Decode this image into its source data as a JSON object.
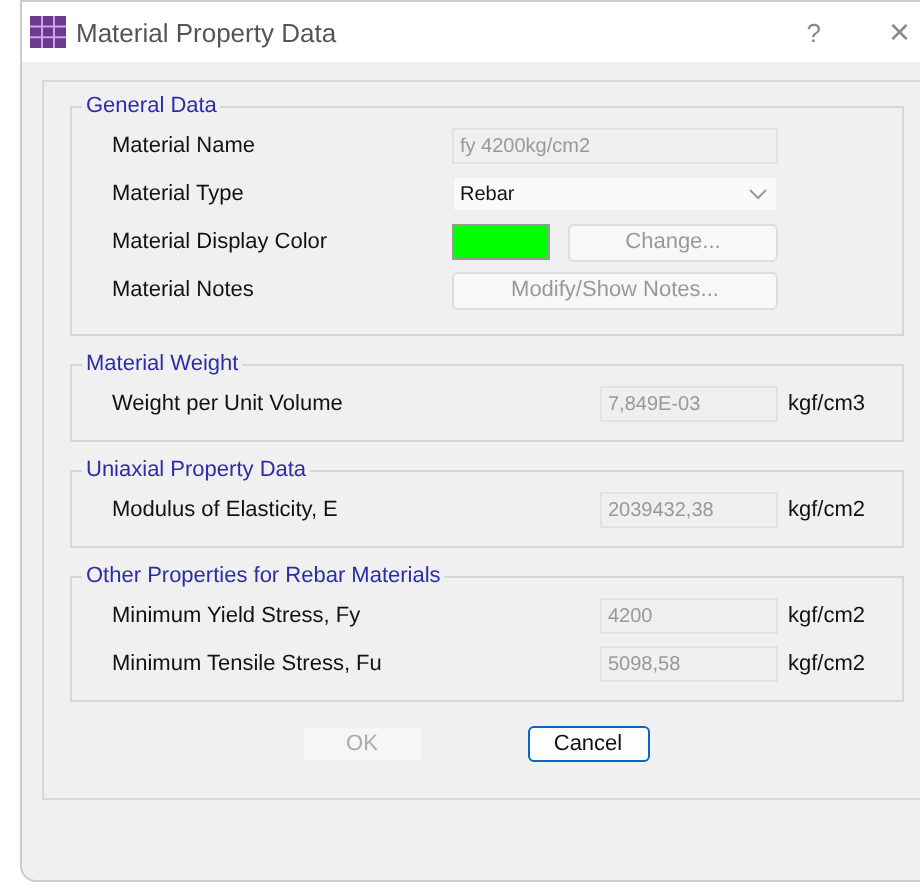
{
  "window": {
    "title": "Material Property Data",
    "help": "?",
    "close": "×"
  },
  "groups": [
    {
      "title": "General Data",
      "rows": [
        {
          "kind": "text",
          "label": "Material Name",
          "value": "fy 4200kg/cm2",
          "disabled": true
        },
        {
          "kind": "dropdown",
          "label": "Material Type",
          "value": "Rebar",
          "disabled": false
        },
        {
          "kind": "color",
          "label": "Material Display Color",
          "color": "#00ff00",
          "button": "Change...",
          "disabled": true
        },
        {
          "kind": "button",
          "label": "Material Notes",
          "button": "Modify/Show Notes...",
          "disabled": true
        }
      ]
    },
    {
      "title": "Material Weight",
      "rows": [
        {
          "kind": "number",
          "label": "Weight per Unit Volume",
          "value": "7,849E-03",
          "unit": "kgf/cm3",
          "disabled": true
        }
      ]
    },
    {
      "title": "Uniaxial Property Data",
      "rows": [
        {
          "kind": "number",
          "label": "Modulus of Elasticity,  E",
          "value": "2039432,38",
          "unit": "kgf/cm2",
          "disabled": true
        }
      ]
    },
    {
      "title": "Other Properties for Rebar Materials",
      "rows": [
        {
          "kind": "number",
          "label": "Minimum Yield Stress, Fy",
          "value": "4200",
          "unit": "kgf/cm2",
          "disabled": true
        },
        {
          "kind": "number",
          "label": "Minimum Tensile Stress, Fu",
          "value": "5098,58",
          "unit": "kgf/cm2",
          "disabled": true
        }
      ]
    }
  ],
  "buttons": [
    {
      "label": "OK",
      "disabled": true
    },
    {
      "label": "Cancel",
      "disabled": false
    }
  ]
}
